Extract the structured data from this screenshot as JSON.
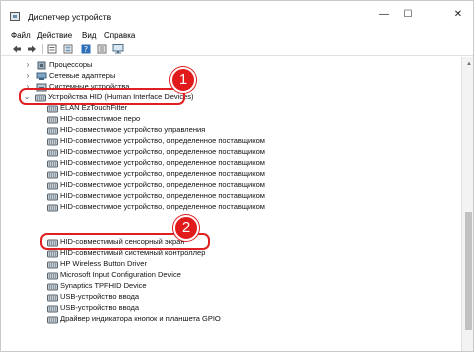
{
  "window": {
    "title": "Диспетчер устройств",
    "controls": {
      "minimize": "—",
      "maximize": "☐",
      "close": "✕"
    }
  },
  "menu": [
    "Файл",
    "Действие",
    "Вид",
    "Справка"
  ],
  "toolbar": [
    "back-arrow-icon",
    "forward-arrow-icon",
    "properties-icon",
    "list-view-icon",
    "help-icon",
    "details-icon",
    "monitor-icon"
  ],
  "tree": {
    "items": [
      {
        "label": "Процессоры",
        "expanded": false
      },
      {
        "label": "Сетевые адаптеры",
        "expanded": false
      },
      {
        "label": "Системные устройства",
        "expanded": false
      },
      {
        "label": "Устройства HID (Human Interface Devices)",
        "expanded": true
      },
      {
        "label": "ELAN EzTouchFilter"
      },
      {
        "label": "HID-совместимое перо"
      },
      {
        "label": "HID-совместимое устройство управления"
      },
      {
        "label": "HID-совместимое устройство, определенное поставщиком"
      },
      {
        "label": "HID-совместимое устройство, определенное поставщиком"
      },
      {
        "label": "HID-совместимое устройство, определенное поставщиком"
      },
      {
        "label": "HID-совместимое устройство, определенное поставщиком"
      },
      {
        "label": "HID-совместимое устройство, определенное поставщиком"
      },
      {
        "label": "HID-совместимое устройство, определенное поставщиком"
      },
      {
        "label": "HID-совместимое устройство, определенное поставщиком"
      },
      {
        "label": "HID-совместимый сенсорный экран"
      },
      {
        "label": "HID-совместимый системный контроллер"
      },
      {
        "label": "HP Wireless Button Driver"
      },
      {
        "label": "Microsoft Input Configuration Device"
      },
      {
        "label": "Synaptics TPFHID Device"
      },
      {
        "label": "USB-устройство ввода"
      },
      {
        "label": "USB-устройство ввода"
      },
      {
        "label": "Драйвер индикатора кнопок и планшета GPIO"
      }
    ]
  },
  "callouts": [
    {
      "number": "1",
      "target": "Устройства HID (Human Interface Devices)"
    },
    {
      "number": "2",
      "target": "HID-совместимый сенсорный экран"
    }
  ],
  "colors": {
    "callout_red": "#e11b1b",
    "scroll_thumb": "#c1c1c1"
  }
}
